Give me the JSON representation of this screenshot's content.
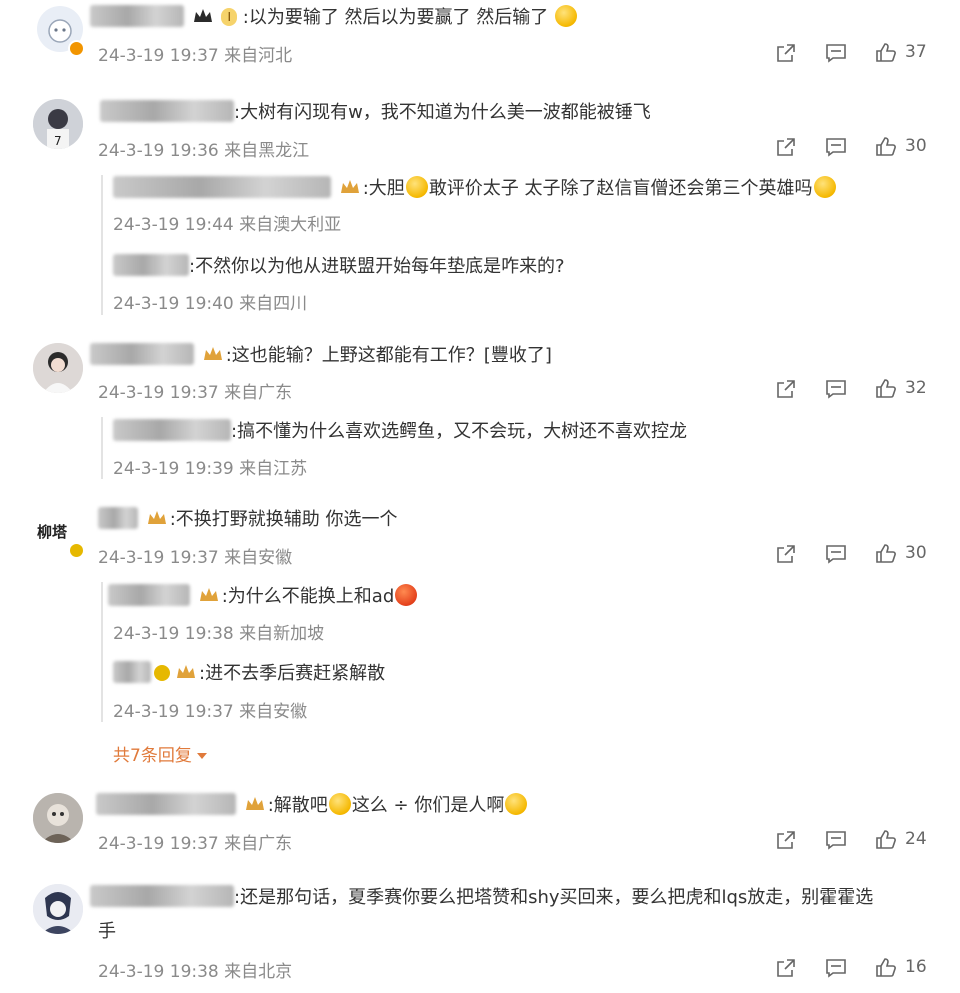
{
  "comments": [
    {
      "text": ":以为要输了 然后以为要赢了 然后输了",
      "level_badge": "I",
      "time": "24-3-19 19:37",
      "location": "来自河北",
      "likes": "37"
    },
    {
      "text": ":大树有闪现有w，我不知道为什么美一波都能被锤飞",
      "time": "24-3-19 19:36",
      "location": "来自黑龙江",
      "likes": "30",
      "replies": [
        {
          "text_a": ":大胆",
          "text_b": "敢评价太子 太子除了赵信盲僧还会第三个英雄吗",
          "time": "24-3-19 19:44",
          "location": "来自澳大利亚"
        },
        {
          "text": ":不然你以为他从进联盟开始每年垫底是咋来的?",
          "time": "24-3-19 19:40",
          "location": "来自四川"
        }
      ]
    },
    {
      "text": ":这也能输？上野这都能有工作？[豐收了]",
      "time": "24-3-19 19:37",
      "location": "来自广东",
      "likes": "32",
      "replies": [
        {
          "text": ":搞不懂为什么喜欢选鳄鱼，又不会玩，大树还不喜欢控龙",
          "time": "24-3-19 19:39",
          "location": "来自江苏"
        }
      ]
    },
    {
      "text": ":不换打野就换辅助 你选一个",
      "time": "24-3-19 19:37",
      "location": "来自安徽",
      "likes": "30",
      "replies": [
        {
          "text": ":为什么不能换上和ad",
          "time": "24-3-19 19:38",
          "location": "来自新加坡"
        },
        {
          "text": ":进不去季后赛赶紧解散",
          "time": "24-3-19 19:37",
          "location": "来自安徽"
        }
      ],
      "more_replies": "共7条回复"
    },
    {
      "text_a": ":解散吧",
      "text_b": "这么 ÷ 你们是人啊",
      "time": "24-3-19 19:37",
      "location": "来自广东",
      "likes": "24"
    },
    {
      "text_line1": ":还是那句话，夏季赛你要么把塔赞和shy买回来，要么把虎和lqs放走，别霍霍选",
      "text_line2": "手",
      "time": "24-3-19 19:38",
      "location": "来自北京",
      "likes": "16"
    }
  ],
  "icons": {
    "share": "share-icon",
    "comment": "comment-icon",
    "like": "like-icon"
  },
  "colors": {
    "more_link": "#e07a3b",
    "meta": "#8a8a8a"
  }
}
